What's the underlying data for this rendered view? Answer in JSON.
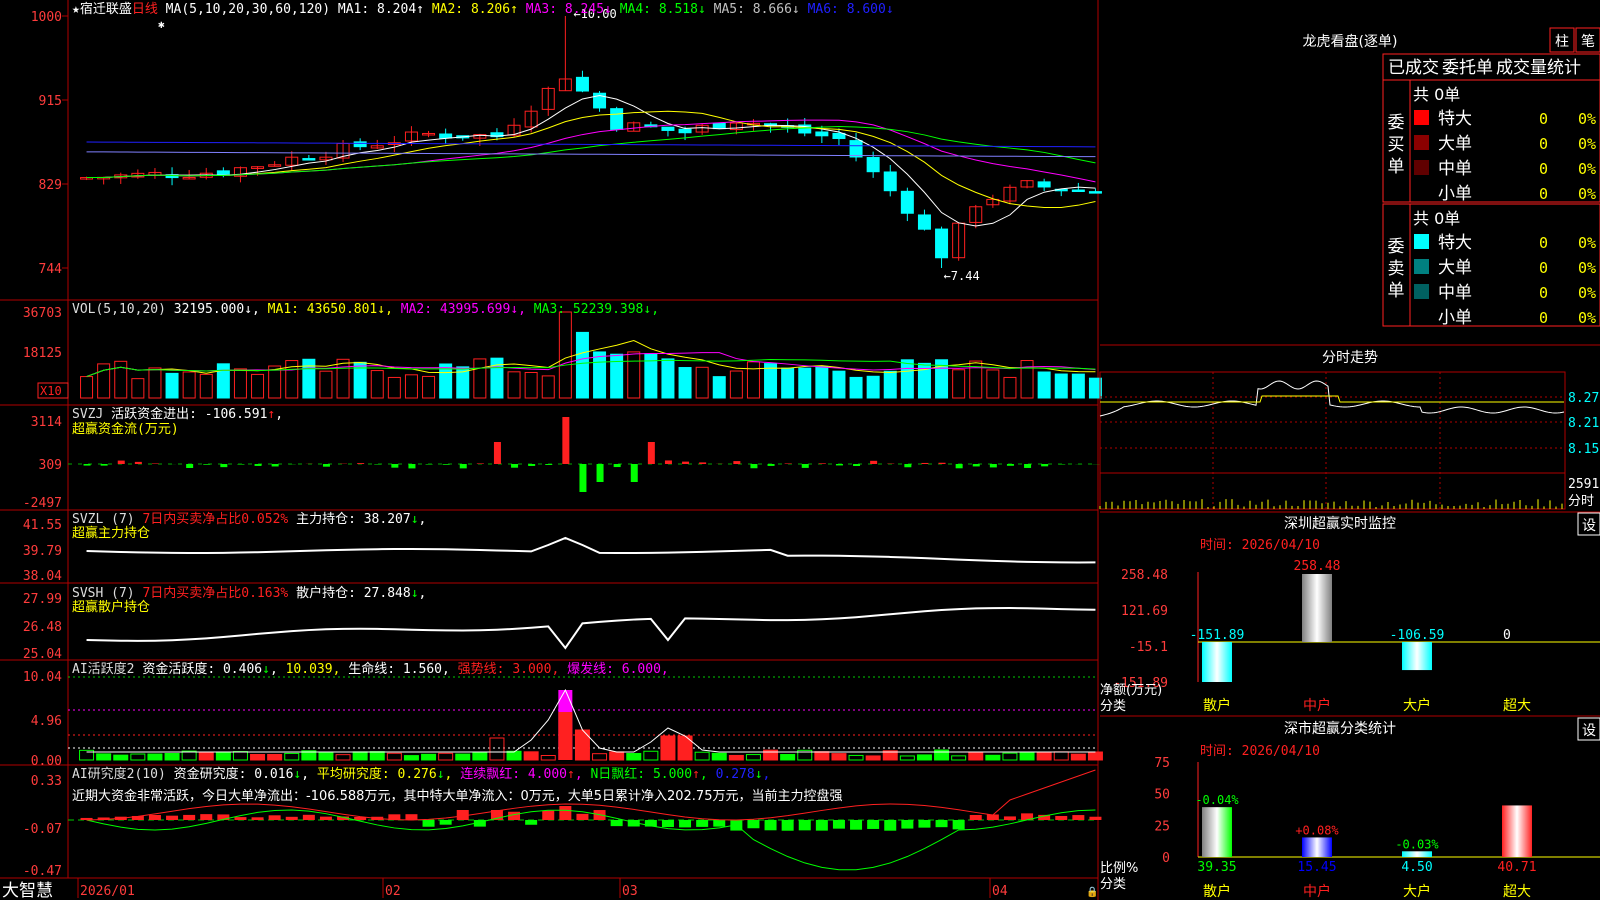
{
  "app": {
    "name": "大智慧",
    "lock_icon": "lock-icon"
  },
  "stock": {
    "star": "★",
    "name": "宿迁联盛",
    "period": "日线",
    "marker": "✱"
  },
  "colors": {
    "up": "#ff2020",
    "down": "#00ffff",
    "grid": "#b00000",
    "axis_text": "#ff3c3c",
    "ma1": "#ffffff",
    "ma2": "#ffff00",
    "ma3": "#ff00ff",
    "ma4": "#00ff00",
    "ma5": "#8080ff",
    "ma6": "#2020ff"
  },
  "main_indicator": {
    "label": "MA(5,10,20,30,60,120)",
    "items": [
      {
        "name": "MA1:",
        "value": "8.204",
        "arrow": "↑",
        "color": "#ffffff"
      },
      {
        "name": "MA2:",
        "value": "8.206",
        "arrow": "↑",
        "color": "#ffff00"
      },
      {
        "name": "MA3:",
        "value": "8.245",
        "arrow": "↓",
        "color": "#ff00ff"
      },
      {
        "name": "MA4:",
        "value": "8.518",
        "arrow": "↓",
        "color": "#00ff00"
      },
      {
        "name": "MA5:",
        "value": "8.666",
        "arrow": "↓",
        "color": "#c0c0c0"
      },
      {
        "name": "MA6:",
        "value": "8.600",
        "arrow": "↓",
        "color": "#2020ff"
      }
    ],
    "y_ticks": [
      "1000",
      "915",
      "829",
      "744"
    ],
    "high_label": "10.00",
    "low_label": "7.44"
  },
  "vol_indicator": {
    "label": "VOL(5,10,20)",
    "value": "32195.000",
    "value_arrow": "↓",
    "items": [
      {
        "name": "MA1:",
        "value": "43650.801",
        "arrow": "↓",
        "color": "#ffff00"
      },
      {
        "name": "MA2:",
        "value": "43995.699",
        "arrow": "↓",
        "color": "#ff00ff"
      },
      {
        "name": "MA3:",
        "value": "52239.398",
        "arrow": "↓",
        "color": "#00ff00"
      }
    ],
    "y_ticks": [
      "36703",
      "18125"
    ],
    "unit_badge": "X10"
  },
  "svzj": {
    "title": "SVZJ",
    "label": "活跃资金进出:",
    "value": "-106.591",
    "arrow": "↑",
    "trail": ",",
    "sub": "超赢资金流(万元)",
    "y_ticks": [
      "3114",
      "309",
      "-2497"
    ]
  },
  "svzl": {
    "title": "SVZL (7)",
    "label": "7日内买卖净占比0.052%",
    "hold_label": "主力持仓:",
    "value": "38.207",
    "arrow": "↓",
    "trail": ",",
    "sub": "超赢主力持仓",
    "y_ticks": [
      "41.55",
      "39.79",
      "38.04"
    ]
  },
  "svsh": {
    "title": "SVSH (7)",
    "label": "7日内买卖净占比0.163%",
    "hold_label": "散户持仓:",
    "value": "27.848",
    "arrow": "↓",
    "trail": ",",
    "sub": "超赢散户持仓",
    "y_ticks": [
      "27.99",
      "26.48",
      "25.04"
    ]
  },
  "ai_active": {
    "title": "AI活跃度2",
    "items": [
      {
        "text": "资金活跃度: 0.406",
        "arrow": "↓",
        "color": "#ffffff"
      },
      {
        "text": "10.039",
        "arrow": "",
        "color": "#ffff00"
      },
      {
        "text": "生命线: 1.560",
        "arrow": "",
        "color": "#ffffff"
      },
      {
        "text": "强势线: 3.000",
        "arrow": "",
        "color": "#ff2020"
      },
      {
        "text": "爆发线: 6.000",
        "arrow": "",
        "color": "#ff00ff"
      }
    ],
    "y_ticks": [
      "10.04",
      "4.96",
      "0.00"
    ]
  },
  "ai_research": {
    "title": "AI研究度2(10)",
    "items": [
      {
        "text": "资金研究度: 0.016",
        "arrow": "↓",
        "color": "#ffffff"
      },
      {
        "text": "平均研究度: 0.276",
        "arrow": "↓",
        "color": "#ffff00"
      },
      {
        "text": "连续飘红: 4.000",
        "arrow": "↑",
        "color": "#ff00ff"
      },
      {
        "text": "N日飘红: 5.000",
        "arrow": "↑",
        "color": "#00ff00"
      },
      {
        "text": "0.278",
        "arrow": "↓",
        "color": "#2020ff"
      }
    ],
    "comment": "近期大资金非常活跃，今日大单净流出：-106.588万元，其中特大单净流入：0万元，大单5日累计净入202.75万元，当前主力控盘强",
    "y_ticks": [
      "0.33",
      "-0.07",
      "-0.47"
    ]
  },
  "date_axis": [
    "2026/01",
    "02",
    "03",
    "04"
  ],
  "dragon_tiger": {
    "title": "龙虎看盘(逐单)",
    "btn_bar": "柱",
    "btn_pen": "笔",
    "tabs": [
      "已成交",
      "委托单",
      "成交量统计"
    ],
    "buy": {
      "side_label": "委\n买\n单",
      "total": "共 0单",
      "rows": [
        {
          "label": "特大",
          "count": "0",
          "pct": "0%",
          "color": "#ff0000"
        },
        {
          "label": "大单",
          "count": "0",
          "pct": "0%",
          "color": "#8b0000"
        },
        {
          "label": "中单",
          "count": "0",
          "pct": "0%",
          "color": "#600000"
        },
        {
          "label": "小单",
          "count": "0",
          "pct": "0%",
          "color": ""
        }
      ]
    },
    "sell": {
      "side_label": "委\n卖\n单",
      "total": "共 0单",
      "rows": [
        {
          "label": "特大",
          "count": "0",
          "pct": "0%",
          "color": "#00ffff"
        },
        {
          "label": "大单",
          "count": "0",
          "pct": "0%",
          "color": "#008080"
        },
        {
          "label": "中单",
          "count": "0",
          "pct": "0%",
          "color": "#006060"
        },
        {
          "label": "小单",
          "count": "0",
          "pct": "0%",
          "color": ""
        }
      ]
    }
  },
  "intraday": {
    "title": "分时走势",
    "y_ticks": [
      "8.27",
      "8.21",
      "8.15"
    ],
    "vol_tick": "2591",
    "vol_unit": "分时"
  },
  "monitor": {
    "title": "深圳超赢实时监控",
    "settings": "设",
    "time": "时间: 2026/04/10",
    "y_ticks": [
      "258.48",
      "121.69",
      "-15.1",
      "-151.89"
    ],
    "unit_label": "净额(万元)",
    "cat_label": "分类",
    "categories": [
      "散户",
      "中户",
      "大户",
      "超大"
    ],
    "values": [
      -151.89,
      258.48,
      -106.59,
      0
    ],
    "value_labels": [
      "-151.89",
      "258.48",
      "-106.59",
      "0"
    ]
  },
  "classify": {
    "title": "深市超赢分类统计",
    "settings": "设",
    "time": "时间: 2026/04/10",
    "y_ticks": [
      "75",
      "50",
      "25",
      "0"
    ],
    "unit_label": "比例%",
    "cat_label": "分类",
    "categories": [
      "散户",
      "中户",
      "大户",
      "超大"
    ],
    "values": [
      39.35,
      15.45,
      4.5,
      40.71
    ],
    "value_labels": [
      "39.35",
      "15.45",
      "4.50",
      "40.71"
    ],
    "change_labels": [
      "-0.04%",
      "+0.08%",
      "-0.03%",
      ""
    ]
  },
  "chart_data": [
    {
      "type": "bar",
      "title": "深圳超赢实时监控",
      "ylabel": "净额(万元)",
      "categories": [
        "散户",
        "中户",
        "大户",
        "超大"
      ],
      "values": [
        -151.89,
        258.48,
        -106.59,
        0
      ],
      "ylim": [
        -151.89,
        258.48
      ]
    },
    {
      "type": "bar",
      "title": "深市超赢分类统计",
      "ylabel": "比例%",
      "categories": [
        "散户",
        "中户",
        "大户",
        "超大"
      ],
      "values": [
        39.35,
        15.45,
        4.5,
        40.71
      ],
      "ylim": [
        0,
        75
      ]
    }
  ]
}
